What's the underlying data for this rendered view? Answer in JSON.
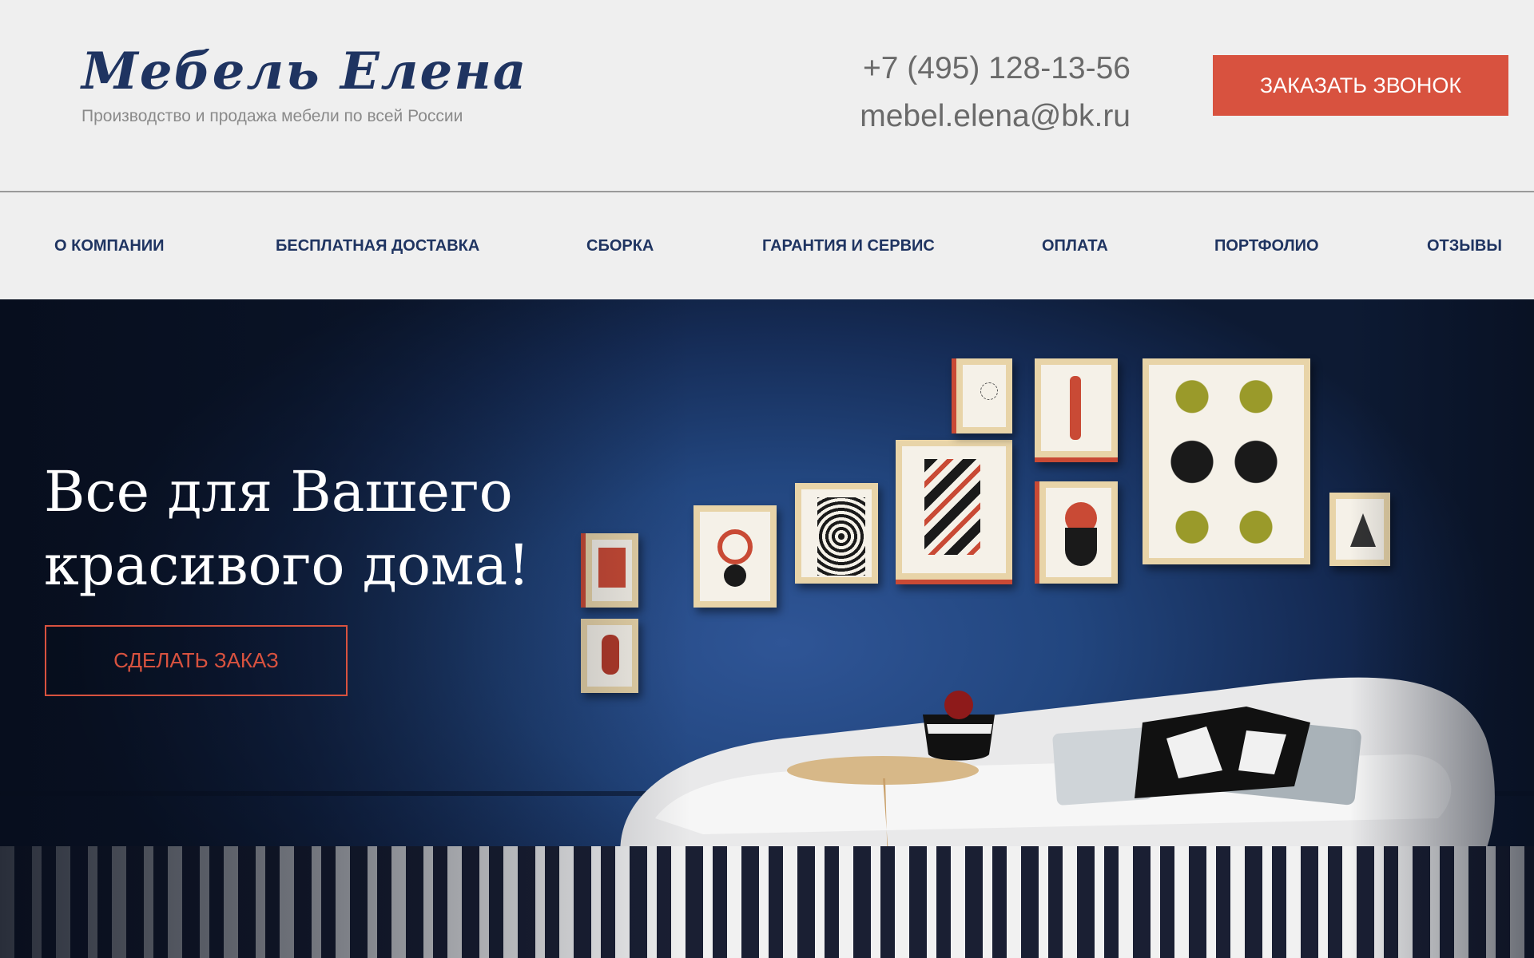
{
  "header": {
    "logo_title": "Мебель Елена",
    "logo_subtitle": "Производство и продажа мебели по всей России",
    "phone": "+7 (495) 128-13-56",
    "email": "mebel.elena@bk.ru",
    "call_button": "ЗАКАЗАТЬ ЗВОНОК"
  },
  "nav": {
    "items": [
      {
        "label": "О КОМПАНИИ"
      },
      {
        "label": "БЕСПЛАТНАЯ ДОСТАВКА"
      },
      {
        "label": "СБОРКА"
      },
      {
        "label": "ГАРАНТИЯ И СЕРВИС"
      },
      {
        "label": "ОПЛАТА"
      },
      {
        "label": "ПОРТФОЛИО"
      },
      {
        "label": "ОТЗЫВЫ"
      }
    ]
  },
  "hero": {
    "title_line1": "Все для Вашего",
    "title_line2": "красивого дома!",
    "order_button": "СДЕЛАТЬ ЗАКАЗ"
  },
  "colors": {
    "accent": "#d8523f",
    "brand": "#1f3461",
    "background": "#efefef"
  }
}
